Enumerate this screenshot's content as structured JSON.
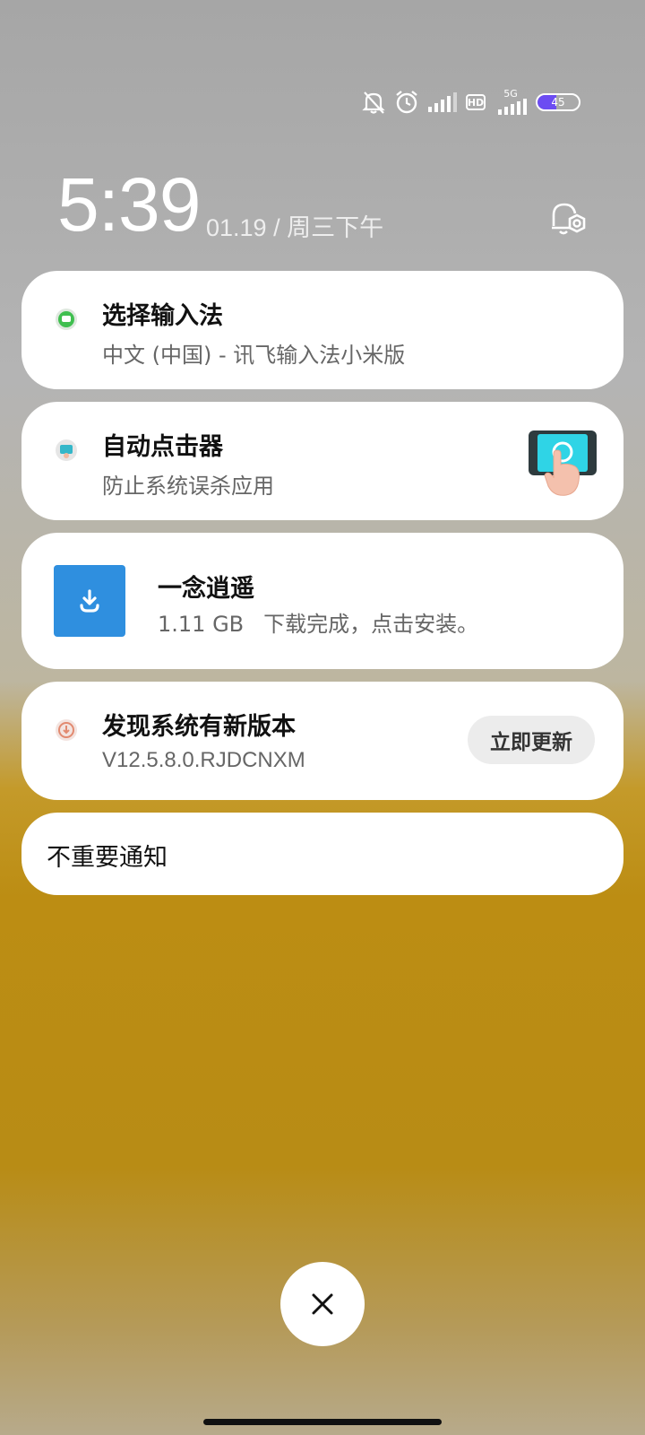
{
  "status_bar": {
    "network_label": "5G",
    "hd_label": "HD",
    "battery_percent": 45,
    "battery_label": "45",
    "icons": [
      "bell-off-icon",
      "alarm-icon",
      "signal-icon",
      "hd-icon",
      "signal-5g-icon",
      "battery-icon"
    ]
  },
  "lockscreen": {
    "time": "5:39",
    "date": "01.19 / 周三下午",
    "settings_icon": "notification-settings-icon"
  },
  "notifications": [
    {
      "title": "选择输入法",
      "text": "中文 (中国) - 讯飞输入法小米版",
      "icon": "input-method-icon"
    },
    {
      "title": "自动点击器",
      "text": "防止系统误杀应用",
      "icon": "auto-clicker-icon",
      "image": "tap-phone-image"
    },
    {
      "title": "一念逍遥",
      "size": "1.11 GB",
      "text": "下载完成，点击安装。",
      "icon": "download-icon"
    },
    {
      "title": "发现系统有新版本",
      "text": "V12.5.8.0.RJDCNXM",
      "button": "立即更新",
      "icon": "system-update-icon"
    }
  ],
  "unimportant": {
    "label": "不重要通知"
  },
  "clear_button": {
    "icon": "close-icon"
  },
  "colors": {
    "accent_download": "#2f8fdf",
    "battery_fill": "#6c4cf2"
  }
}
